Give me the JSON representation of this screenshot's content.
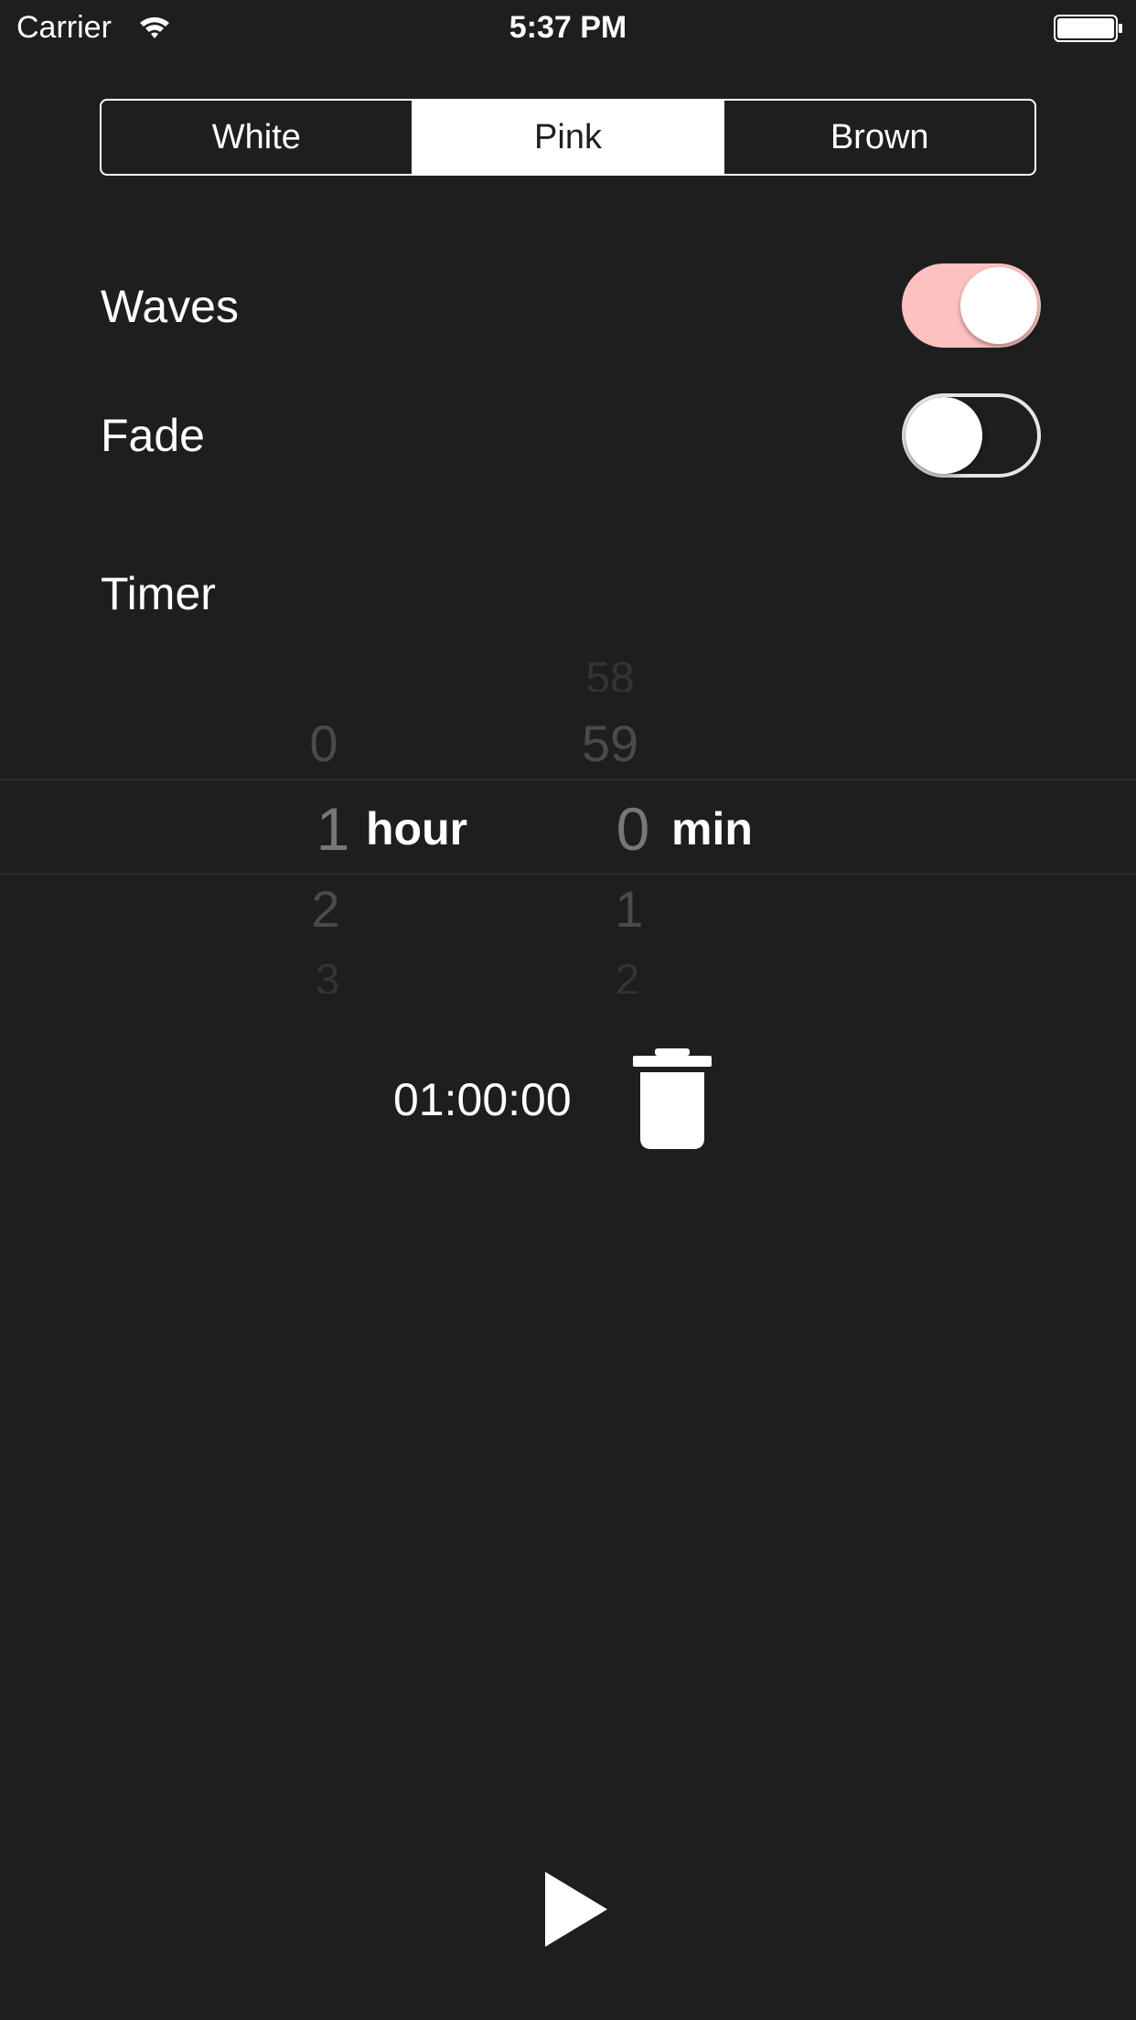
{
  "status_bar": {
    "carrier": "Carrier",
    "time": "5:37 PM",
    "icons": [
      "wifi-icon",
      "battery-icon"
    ]
  },
  "noise_type": {
    "options": [
      "White",
      "Pink",
      "Brown"
    ],
    "selected": "Pink"
  },
  "settings": {
    "waves": {
      "label": "Waves",
      "on": true,
      "on_color": "#ffc1c0"
    },
    "fade": {
      "label": "Fade",
      "on": false
    }
  },
  "timer": {
    "label": "Timer",
    "picker": {
      "hours": {
        "above": [
          "0"
        ],
        "selected": "1",
        "below": [
          "2",
          "3"
        ],
        "unit": "hour"
      },
      "minutes": {
        "above": [
          "58",
          "59"
        ],
        "selected": "0",
        "below": [
          "1",
          "2"
        ],
        "unit": "min"
      }
    },
    "countdown": "01:00:00",
    "clear_icon": "trash-icon"
  },
  "controls": {
    "play_icon": "play-icon"
  },
  "colors": {
    "background": "#1e1e1e",
    "foreground": "#ffffff",
    "accent_pink": "#ffc1c0"
  }
}
